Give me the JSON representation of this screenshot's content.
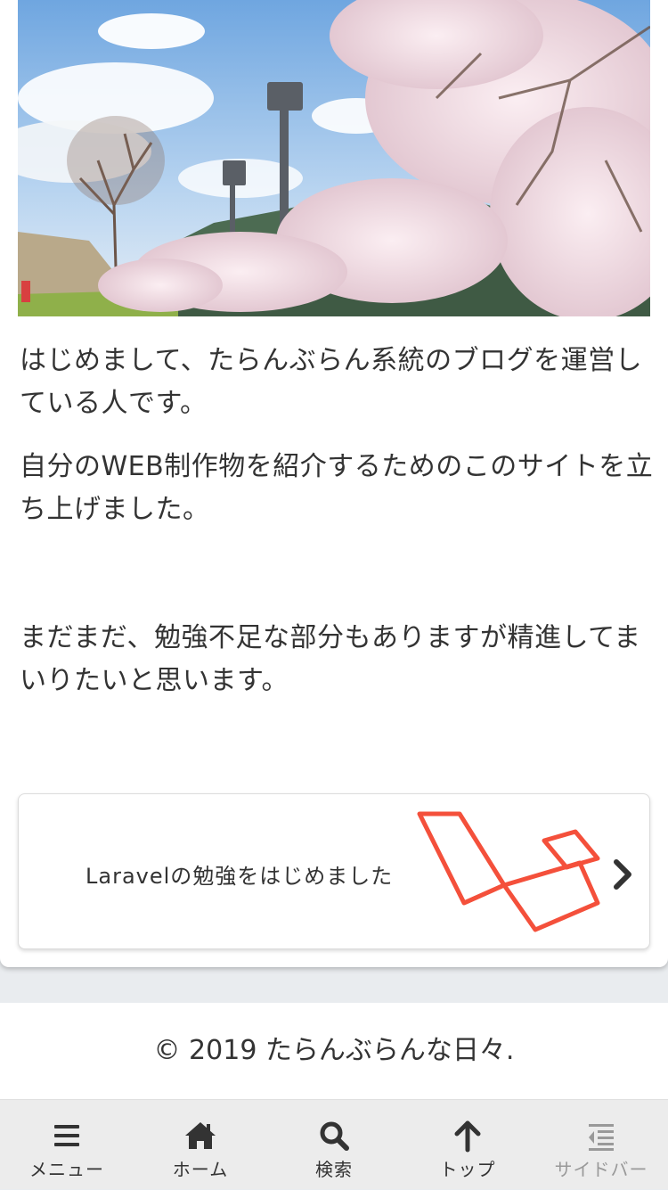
{
  "article": {
    "paragraphs": [
      "はじめまして、たらんぶらん系統のブログを運営している人です。",
      "自分のWEB制作物を紹介するためのこのサイトを立ち上げました。",
      "まだまだ、勉強不足な部分もありますが精進してまいりたいと思います。"
    ]
  },
  "blogcard": {
    "title": "Laravelの勉強をはじめました",
    "thumb_icon": "laravel-logo",
    "accent": "#f4503b"
  },
  "footer": {
    "copyright": "© 2019 たらんぶらんな日々."
  },
  "bottom_nav": {
    "items": [
      {
        "label": "メニュー",
        "icon": "menu-icon"
      },
      {
        "label": "ホーム",
        "icon": "home-icon"
      },
      {
        "label": "検索",
        "icon": "search-icon"
      },
      {
        "label": "トップ",
        "icon": "arrow-up-icon"
      },
      {
        "label": "サイドバー",
        "icon": "sidebar-icon",
        "disabled": true
      }
    ]
  }
}
